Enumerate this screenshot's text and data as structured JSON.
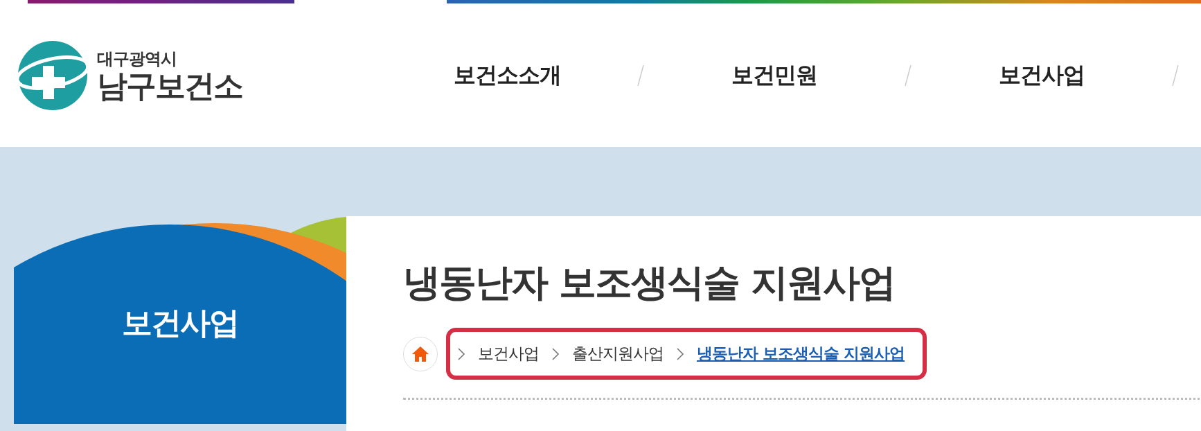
{
  "logo": {
    "city": "대구광역시",
    "name": "남구보건소"
  },
  "nav": [
    {
      "label": "보건소소개"
    },
    {
      "label": "보건민원"
    },
    {
      "label": "보건사업"
    }
  ],
  "sidebar": {
    "title": "보건사업"
  },
  "page_title": "냉동난자 보조생식술 지원사업",
  "breadcrumb": [
    {
      "label": "보건사업",
      "current": false
    },
    {
      "label": "출산지원사업",
      "current": false
    },
    {
      "label": "냉동난자 보조생식술 지원사업",
      "current": true
    }
  ]
}
